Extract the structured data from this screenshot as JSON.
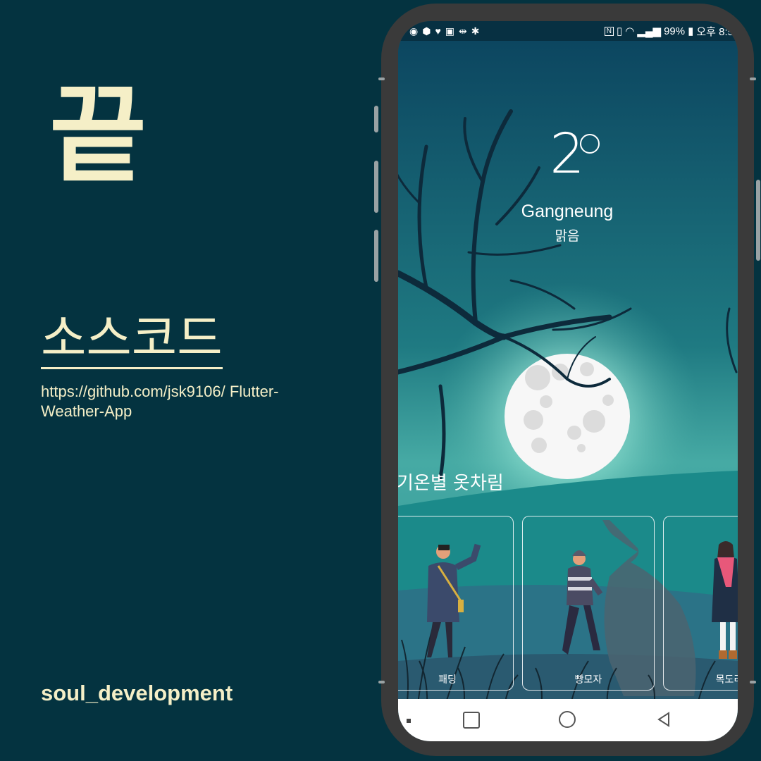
{
  "slide": {
    "title": "끝",
    "source_heading": "소스코드",
    "repo_url": "https://github.com/jsk9106/ Flutter-Weather-App",
    "author": "soul_development"
  },
  "statusbar": {
    "battery": "99%",
    "time": "오후 8:5"
  },
  "weather": {
    "temperature": "2",
    "city": "Gangneung",
    "condition": "맑음"
  },
  "outfits": {
    "section_title": "기온별 옷차림",
    "cards": [
      {
        "label": "패딩"
      },
      {
        "label": "빵모자"
      },
      {
        "label": "목도리"
      }
    ]
  },
  "colors": {
    "background": "#043340",
    "accent_text": "#f5efc7",
    "sky_top": "#0c4660",
    "sky_mid": "#2a8d8f",
    "moon": "#f7f7f7"
  }
}
